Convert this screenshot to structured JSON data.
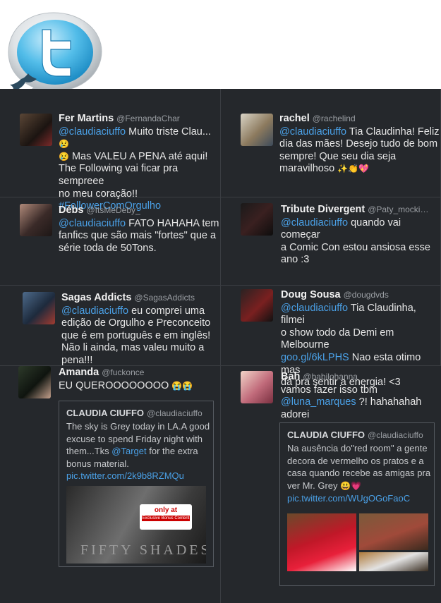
{
  "tweets": [
    {
      "name": "Fer Martins",
      "handle": "@FernandaChar",
      "lines": [
        {
          "mention": "@claudiaciuffo",
          "text": " Muito triste Clau... ",
          "emoji": "😢"
        },
        {
          "emoji": "😢",
          "text": " Mas VALEU A PENA até aqui!"
        },
        {
          "text": "The Following vai ficar pra sempreee"
        },
        {
          "text": "no meu coração!!"
        },
        {
          "link": "#FollowerComOrgulho"
        }
      ]
    },
    {
      "name": "rachel",
      "handle": "@rachelind",
      "lines": [
        {
          "mention": "@claudiaciuffo",
          "text": " Tia Claudinha! Feliz"
        },
        {
          "text": "dia das mães! Desejo tudo de bom"
        },
        {
          "text": "sempre! Que seu dia seja"
        },
        {
          "text": "maravilhoso ",
          "emoji": "✨👏💖"
        }
      ]
    },
    {
      "name": "Débs",
      "handle": "@ItsMeDeby_",
      "lines": [
        {
          "mention": "@claudiaciuffo",
          "text": " FATO HAHAHA tem"
        },
        {
          "text": "fanfics que são mais \"fortes\" que a"
        },
        {
          "text": "série toda de 50Tons."
        }
      ]
    },
    {
      "name": "Tribute Divergent",
      "handle": "@Paty_mocki…",
      "lines": [
        {
          "mention": "@claudiaciuffo",
          "text": " quando vai começar"
        },
        {
          "text": "a Comic Con estou ansiosa esse"
        },
        {
          "text": "ano :3"
        }
      ]
    },
    {
      "name": "Sagas Addicts",
      "handle": "@SagasAddicts",
      "lines": [
        {
          "mention": "@claudiaciuffo",
          "text": " eu comprei uma"
        },
        {
          "text": "edição de Orgulho e Preconceito"
        },
        {
          "text": "que é em português e em inglês!"
        },
        {
          "text": "Não li ainda, mas valeu muito a"
        },
        {
          "text": "pena!!!"
        }
      ]
    },
    {
      "name": "Doug Sousa",
      "handle": "@dougdvds",
      "lines": [
        {
          "mention": "@claudiaciuffo",
          "text": " Tia Claudinha, filmei"
        },
        {
          "text": "o show todo da Demi em Melbourne"
        },
        {
          "link": "goo.gl/6kLPHS",
          "text": " Nao esta otimo mas"
        },
        {
          "text": "da pra sentir a energia! <3"
        }
      ]
    },
    {
      "name": "Amanda",
      "handle": "@fuckonce",
      "lines": [
        {
          "text": "EU QUEROOOOOOOO ",
          "emoji": "😭😭"
        }
      ]
    },
    {
      "name": "Bah",
      "handle": "@babilohanna",
      "lines": [
        {
          "text": "vamos fazer isso tbm"
        },
        {
          "mention": "@luna_marques",
          "text": " ?! hahahahah"
        },
        {
          "text": "adorei"
        }
      ]
    }
  ],
  "quote1": {
    "name": "CLAUDIA CIUFFO",
    "handle": "@claudiaciuffo",
    "lines": [
      {
        "text": "The sky is Grey today in LA.A good"
      },
      {
        "text": "excuse to spend Friday night with"
      },
      {
        "text": "them...Tks ",
        "mention": "@Target",
        "tail": " for the extra"
      },
      {
        "text": "bonus material."
      },
      {
        "link": "pic.twitter.com/2k9b8RZMQu"
      }
    ],
    "badge_top": "only at",
    "badge_sub": "Exclusive Bonus Content",
    "movie": "FIFTY SHADES"
  },
  "quote2": {
    "name": "CLAUDIA CIUFFO",
    "handle": "@claudiaciuffo",
    "lines": [
      {
        "text": "Na ausência do\"red room\" a gente"
      },
      {
        "text": "decora de vermelho os pratos e a"
      },
      {
        "text": "casa quando recebe as amigas pra"
      },
      {
        "text": "ver Mr. Grey ",
        "emoji": "😃💗"
      },
      {
        "link": "pic.twitter.com/WUgOGoFaoC"
      }
    ]
  },
  "colors": {
    "background": "#25282c",
    "link": "#4aa0e6",
    "text": "#e6e6e6",
    "handle": "#9a9ea3"
  }
}
